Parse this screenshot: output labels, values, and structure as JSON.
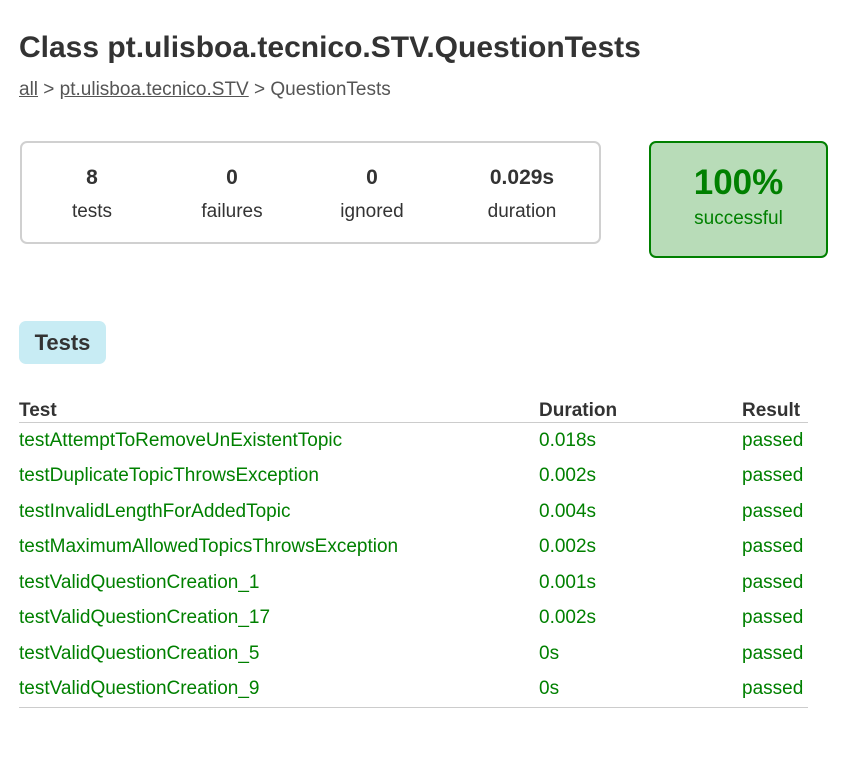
{
  "title": "Class pt.ulisboa.tecnico.STV.QuestionTests",
  "breadcrumbs": {
    "all": "all",
    "sep1": " > ",
    "package": "pt.ulisboa.tecnico.STV",
    "sep2": " > ",
    "current": "QuestionTests"
  },
  "summary": {
    "tests": {
      "value": "8",
      "label": "tests"
    },
    "failures": {
      "value": "0",
      "label": "failures"
    },
    "ignored": {
      "value": "0",
      "label": "ignored"
    },
    "duration": {
      "value": "0.029s",
      "label": "duration"
    }
  },
  "success": {
    "percent": "100%",
    "label": "successful"
  },
  "tab": {
    "label": "Tests"
  },
  "table": {
    "headers": {
      "test": "Test",
      "duration": "Duration",
      "result": "Result"
    },
    "rows": [
      {
        "test": "testAttemptToRemoveUnExistentTopic",
        "duration": "0.018s",
        "result": "passed"
      },
      {
        "test": "testDuplicateTopicThrowsException",
        "duration": "0.002s",
        "result": "passed"
      },
      {
        "test": "testInvalidLengthForAddedTopic",
        "duration": "0.004s",
        "result": "passed"
      },
      {
        "test": "testMaximumAllowedTopicsThrowsException",
        "duration": "0.002s",
        "result": "passed"
      },
      {
        "test": "testValidQuestionCreation_1",
        "duration": "0.001s",
        "result": "passed"
      },
      {
        "test": "testValidQuestionCreation_17",
        "duration": "0.002s",
        "result": "passed"
      },
      {
        "test": "testValidQuestionCreation_5",
        "duration": "0s",
        "result": "passed"
      },
      {
        "test": "testValidQuestionCreation_9",
        "duration": "0s",
        "result": "passed"
      }
    ]
  },
  "colors": {
    "success": "#008000",
    "success_bg": "#b8dcb8",
    "tab_bg": "#c8ecf4"
  }
}
